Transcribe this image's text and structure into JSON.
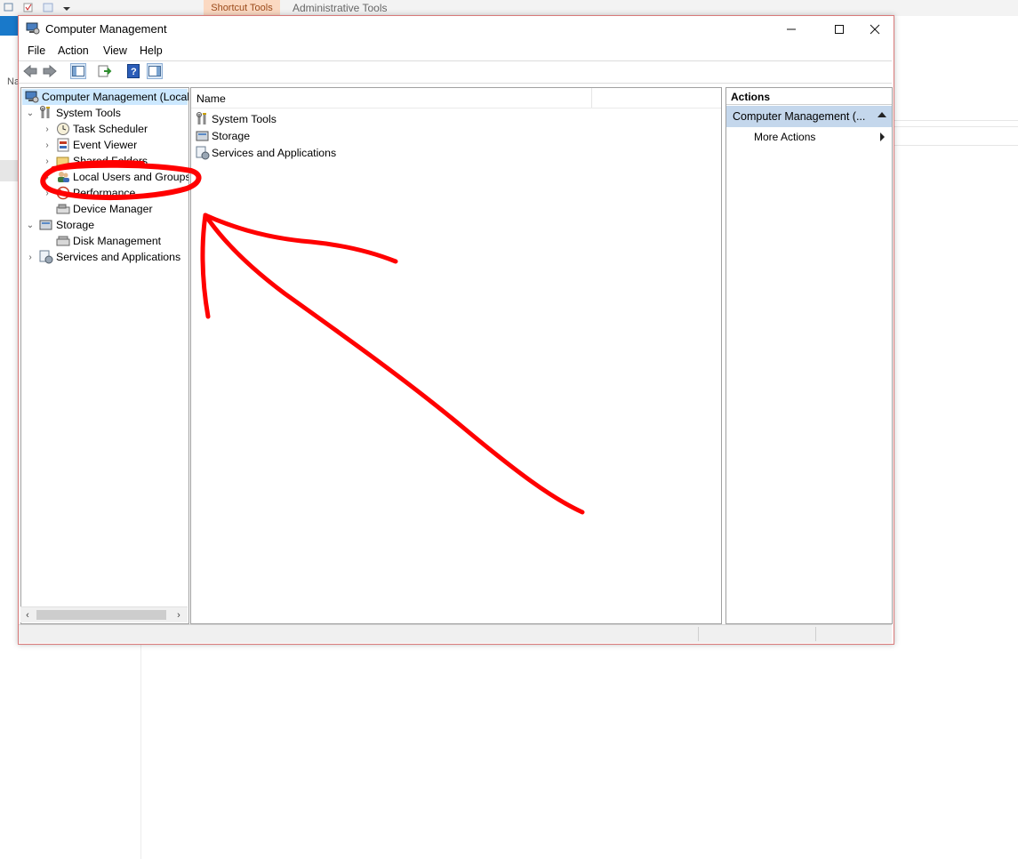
{
  "background": {
    "ribbon_tabs": {
      "shortcut_tools": "Shortcut Tools",
      "administrative_tools": "Administrative Tools"
    },
    "nav_fragment": "Na"
  },
  "window": {
    "title": "Computer Management",
    "controls": {
      "minimize": "—",
      "maximize": "☐",
      "close": "✕"
    }
  },
  "menu": [
    "File",
    "Action",
    "View",
    "Help"
  ],
  "toolbar": {
    "icons": [
      "back-icon",
      "forward-icon",
      "show-hide-console-tree-icon",
      "export-list-icon",
      "help-icon",
      "show-hide-action-pane-icon"
    ]
  },
  "tree": {
    "root": "Computer Management (Local",
    "items": [
      {
        "label": "System Tools",
        "expander": "⌄"
      },
      {
        "label": "Task Scheduler",
        "expander": "›"
      },
      {
        "label": "Event Viewer",
        "expander": "›"
      },
      {
        "label": "Shared Folders",
        "expander": "›"
      },
      {
        "label": "Local Users and Groups",
        "expander": "›"
      },
      {
        "label": "Performance",
        "expander": "›"
      },
      {
        "label": "Device Manager",
        "expander": ""
      },
      {
        "label": "Storage",
        "expander": "⌄"
      },
      {
        "label": "Disk Management",
        "expander": ""
      },
      {
        "label": "Services and Applications",
        "expander": "›"
      }
    ],
    "scroll_left": "‹",
    "scroll_right": "›"
  },
  "list": {
    "column_name": "Name",
    "rows": [
      "System Tools",
      "Storage",
      "Services and Applications"
    ]
  },
  "actions": {
    "header": "Actions",
    "group": "Computer Management (...",
    "item": "More Actions"
  },
  "colors": {
    "annotation": "#ff0000",
    "selection": "#cce8ff",
    "actions_group": "#c4d7ec"
  }
}
